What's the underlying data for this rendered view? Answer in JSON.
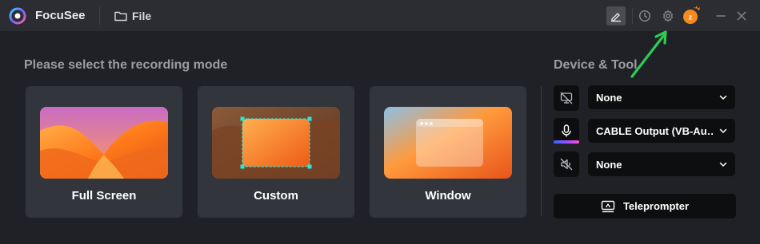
{
  "app": {
    "title": "FocuSee"
  },
  "menu": {
    "file_label": "File"
  },
  "toolbar": {
    "icons": [
      "annotation-icon",
      "history-icon",
      "gear-icon",
      "avatar-icon",
      "minimize-icon",
      "close-icon"
    ],
    "avatar_letter": "z"
  },
  "recording": {
    "heading": "Please select the recording mode",
    "modes": [
      {
        "label": "Full Screen"
      },
      {
        "label": "Custom"
      },
      {
        "label": "Window"
      }
    ]
  },
  "devices": {
    "heading": "Device & Tool",
    "camera": {
      "value": "None",
      "icon": "camera-off-icon"
    },
    "microphone": {
      "value": "CABLE Output (VB-Au…",
      "icon": "microphone-icon"
    },
    "speaker": {
      "value": "None",
      "icon": "speaker-muted-icon"
    },
    "teleprompter_label": "Teleprompter"
  },
  "colors": {
    "background": "#1f2126",
    "titlebar": "#2b2d32",
    "card": "#32353c",
    "control": "#0d0e10",
    "annotation_arrow": "#2ecc54",
    "selection": "#2ee6d6"
  }
}
